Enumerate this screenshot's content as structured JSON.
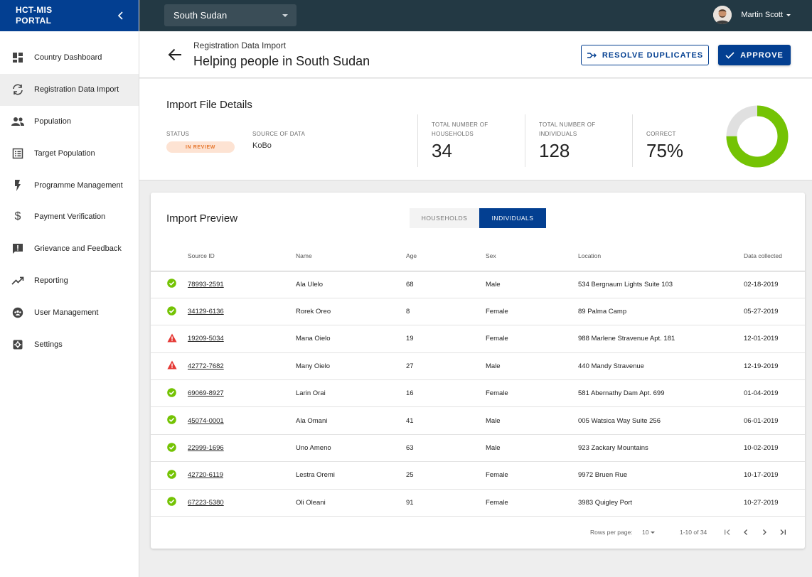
{
  "brand": {
    "title": "HCT-MIS PORTAL"
  },
  "sidebar": {
    "items": [
      {
        "label": "Country Dashboard",
        "icon": "dashboard-icon"
      },
      {
        "label": "Registration Data Import",
        "icon": "sync-icon",
        "active": true
      },
      {
        "label": "Population",
        "icon": "people-icon"
      },
      {
        "label": "Target Population",
        "icon": "list-icon"
      },
      {
        "label": "Programme Management",
        "icon": "flash-icon"
      },
      {
        "label": "Payment Verification",
        "icon": "dollar-icon"
      },
      {
        "label": "Grievance and Feedback",
        "icon": "feedback-icon"
      },
      {
        "label": "Reporting",
        "icon": "trending-up-icon"
      },
      {
        "label": "User Management",
        "icon": "group-icon"
      },
      {
        "label": "Settings",
        "icon": "settings-icon"
      }
    ]
  },
  "topbar": {
    "country": "South Sudan",
    "user_name": "Martin Scott"
  },
  "header": {
    "breadcrumb": "Registration Data Import",
    "title": "Helping people in South Sudan",
    "resolve_label": "RESOLVE DUPLICATES",
    "approve_label": "APPROVE"
  },
  "details": {
    "title": "Import File Details",
    "status_label": "STATUS",
    "status_value": "IN REVIEW",
    "source_label": "SOURCE OF DATA",
    "source_value": "KoBo",
    "households_label_1": "TOTAL NUMBER OF",
    "households_label_2": "HOUSEHOLDS",
    "households_value": "34",
    "individuals_label_1": "TOTAL NUMBER OF",
    "individuals_label_2": "INDIVIDUALS",
    "individuals_value": "128",
    "correct_label": "CORRECT",
    "correct_value": "75%",
    "correct_fraction": 0.75,
    "colors": {
      "correct": "#74c304",
      "incorrect": "#e0e0e0",
      "badge_text": "#e6772e",
      "badge_bg": "#fde3d3",
      "primary": "#033f91"
    }
  },
  "preview": {
    "title": "Import Preview",
    "tab_households": "HOUSEHOLDS",
    "tab_individuals": "INDIVIDUALS",
    "columns": [
      "Source ID",
      "Name",
      "Age",
      "Sex",
      "Location",
      "Data collected"
    ],
    "rows": [
      {
        "status": "ok",
        "id": "78993-2591",
        "name": "Ala Ulelo",
        "age": "68",
        "sex": "Male",
        "location": "534 Bergnaum Lights Suite 103",
        "date": "02-18-2019"
      },
      {
        "status": "ok",
        "id": "34129-6136",
        "name": "Rorek Oreo",
        "age": "8",
        "sex": "Female",
        "location": "89 Palma Camp",
        "date": "05-27-2019"
      },
      {
        "status": "warn",
        "id": "19209-5034",
        "name": "Mana Oielo",
        "age": "19",
        "sex": "Female",
        "location": "988 Marlene Stravenue Apt. 181",
        "date": "12-01-2019"
      },
      {
        "status": "warn",
        "id": "42772-7682",
        "name": "Many Oielo",
        "age": "27",
        "sex": "Male",
        "location": "440 Mandy Stravenue",
        "date": "12-19-2019"
      },
      {
        "status": "ok",
        "id": "69069-8927",
        "name": "Larin Orai",
        "age": "16",
        "sex": "Female",
        "location": "581 Abernathy Dam Apt. 699",
        "date": "01-04-2019"
      },
      {
        "status": "ok",
        "id": "45074-0001",
        "name": "Ala Omani",
        "age": "41",
        "sex": "Male",
        "location": "005 Watsica Way Suite 256",
        "date": "06-01-2019"
      },
      {
        "status": "ok",
        "id": "22999-1696",
        "name": "Uno Ameno",
        "age": "63",
        "sex": "Male",
        "location": "923 Zackary Mountains",
        "date": "10-02-2019"
      },
      {
        "status": "ok",
        "id": "42720-6119",
        "name": "Lestra Oremi",
        "age": "25",
        "sex": "Female",
        "location": "9972 Bruen Rue",
        "date": "10-17-2019"
      },
      {
        "status": "ok",
        "id": "67223-5380",
        "name": "Oli Oleani",
        "age": "91",
        "sex": "Female",
        "location": "3983 Quigley Port",
        "date": "10-27-2019"
      }
    ],
    "pagination": {
      "rows_per_page_label": "Rows per page:",
      "rows_per_page": "10",
      "range": "1-10 of 34"
    }
  }
}
